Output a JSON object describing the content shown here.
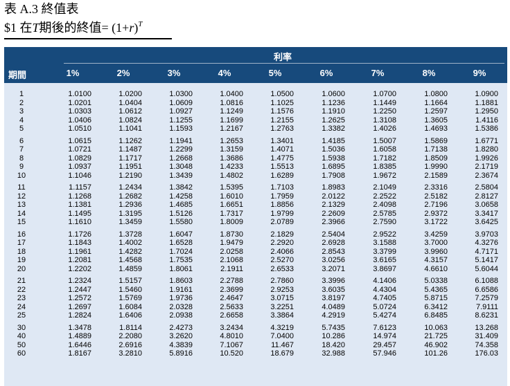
{
  "title": {
    "line1": "表 A.3  終值表",
    "line2_prefix": "$1 在",
    "line2_T": "T",
    "line2_mid": "期後的終值= (1+",
    "line2_r": "r",
    "line2_close": ")",
    "line2_sup": "T"
  },
  "header": {
    "rate_label": "利率",
    "period_label": "期間",
    "rates": [
      "1%",
      "2%",
      "3%",
      "4%",
      "5%",
      "6%",
      "7%",
      "8%",
      "9%"
    ]
  },
  "rows": [
    [
      "1",
      "1.0100",
      "1.0200",
      "1.0300",
      "1.0400",
      "1.0500",
      "1.0600",
      "1.0700",
      "1.0800",
      "1.0900"
    ],
    [
      "2",
      "1.0201",
      "1.0404",
      "1.0609",
      "1.0816",
      "1.1025",
      "1.1236",
      "1.1449",
      "1.1664",
      "1.1881"
    ],
    [
      "3",
      "1.0303",
      "1.0612",
      "1.0927",
      "1.1249",
      "1.1576",
      "1.1910",
      "1.2250",
      "1.2597",
      "1.2950"
    ],
    [
      "4",
      "1.0406",
      "1.0824",
      "1.1255",
      "1.1699",
      "1.2155",
      "1.2625",
      "1.3108",
      "1.3605",
      "1.4116"
    ],
    [
      "5",
      "1.0510",
      "1.1041",
      "1.1593",
      "1.2167",
      "1.2763",
      "1.3382",
      "1.4026",
      "1.4693",
      "1.5386"
    ],
    [
      "6",
      "1.0615",
      "1.1262",
      "1.1941",
      "1.2653",
      "1.3401",
      "1.4185",
      "1.5007",
      "1.5869",
      "1.6771"
    ],
    [
      "7",
      "1.0721",
      "1.1487",
      "1.2299",
      "1.3159",
      "1.4071",
      "1.5036",
      "1.6058",
      "1.7138",
      "1.8280"
    ],
    [
      "8",
      "1.0829",
      "1.1717",
      "1.2668",
      "1.3686",
      "1.4775",
      "1.5938",
      "1.7182",
      "1.8509",
      "1.9926"
    ],
    [
      "9",
      "1.0937",
      "1.1951",
      "1.3048",
      "1.4233",
      "1.5513",
      "1.6895",
      "1.8385",
      "1.9990",
      "2.1719"
    ],
    [
      "10",
      "1.1046",
      "1.2190",
      "1.3439",
      "1.4802",
      "1.6289",
      "1.7908",
      "1.9672",
      "2.1589",
      "2.3674"
    ],
    [
      "11",
      "1.1157",
      "1.2434",
      "1.3842",
      "1.5395",
      "1.7103",
      "1.8983",
      "2.1049",
      "2.3316",
      "2.5804"
    ],
    [
      "12",
      "1.1268",
      "1.2682",
      "1.4258",
      "1.6010",
      "1.7959",
      "2.0122",
      "2.2522",
      "2.5182",
      "2.8127"
    ],
    [
      "13",
      "1.1381",
      "1.2936",
      "1.4685",
      "1.6651",
      "1.8856",
      "2.1329",
      "2.4098",
      "2.7196",
      "3.0658"
    ],
    [
      "14",
      "1.1495",
      "1.3195",
      "1.5126",
      "1.7317",
      "1.9799",
      "2.2609",
      "2.5785",
      "2.9372",
      "3.3417"
    ],
    [
      "15",
      "1.1610",
      "1.3459",
      "1.5580",
      "1.8009",
      "2.0789",
      "2.3966",
      "2.7590",
      "3.1722",
      "3.6425"
    ],
    [
      "16",
      "1.1726",
      "1.3728",
      "1.6047",
      "1.8730",
      "2.1829",
      "2.5404",
      "2.9522",
      "3.4259",
      "3.9703"
    ],
    [
      "17",
      "1.1843",
      "1.4002",
      "1.6528",
      "1.9479",
      "2.2920",
      "2.6928",
      "3.1588",
      "3.7000",
      "4.3276"
    ],
    [
      "18",
      "1.1961",
      "1.4282",
      "1.7024",
      "2.0258",
      "2.4066",
      "2.8543",
      "3.3799",
      "3.9960",
      "4.7171"
    ],
    [
      "19",
      "1.2081",
      "1.4568",
      "1.7535",
      "2.1068",
      "2.5270",
      "3.0256",
      "3.6165",
      "4.3157",
      "5.1417"
    ],
    [
      "20",
      "1.2202",
      "1.4859",
      "1.8061",
      "2.1911",
      "2.6533",
      "3.2071",
      "3.8697",
      "4.6610",
      "5.6044"
    ],
    [
      "21",
      "1.2324",
      "1.5157",
      "1.8603",
      "2.2788",
      "2.7860",
      "3.3996",
      "4.1406",
      "5.0338",
      "6.1088"
    ],
    [
      "22",
      "1.2447",
      "1.5460",
      "1.9161",
      "2.3699",
      "2.9253",
      "3.6035",
      "4.4304",
      "5.4365",
      "6.6586"
    ],
    [
      "23",
      "1.2572",
      "1.5769",
      "1.9736",
      "2.4647",
      "3.0715",
      "3.8197",
      "4.7405",
      "5.8715",
      "7.2579"
    ],
    [
      "24",
      "1.2697",
      "1.6084",
      "2.0328",
      "2.5633",
      "3.2251",
      "4.0489",
      "5.0724",
      "6.3412",
      "7.9111"
    ],
    [
      "25",
      "1.2824",
      "1.6406",
      "2.0938",
      "2.6658",
      "3.3864",
      "4.2919",
      "5.4274",
      "6.8485",
      "8.6231"
    ],
    [
      "30",
      "1.3478",
      "1.8114",
      "2.4273",
      "3.2434",
      "4.3219",
      "5.7435",
      "7.6123",
      "10.063",
      "13.268"
    ],
    [
      "40",
      "1.4889",
      "2.2080",
      "3.2620",
      "4.8010",
      "7.0400",
      "10.286",
      "14.974",
      "21.725",
      "31.409"
    ],
    [
      "50",
      "1.6446",
      "2.6916",
      "4.3839",
      "7.1067",
      "11.467",
      "18.420",
      "29.457",
      "46.902",
      "74.358"
    ],
    [
      "60",
      "1.8167",
      "3.2810",
      "5.8916",
      "10.520",
      "18.679",
      "32.988",
      "57.946",
      "101.26",
      "176.03"
    ]
  ]
}
